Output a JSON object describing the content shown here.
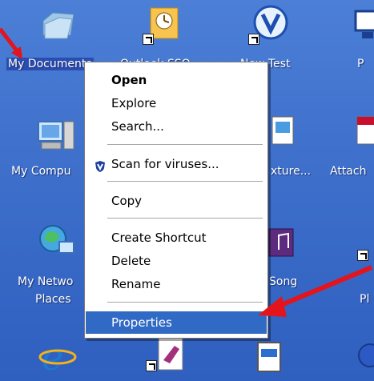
{
  "desktop": {
    "icons": [
      {
        "label": "My Documents"
      },
      {
        "label": "Outlook SSO"
      },
      {
        "label": "New Test"
      },
      {
        "label": "P"
      },
      {
        "label": "My Compu"
      },
      {
        "label": "xture..."
      },
      {
        "label": "Attach"
      },
      {
        "label": "My Netwo"
      },
      {
        "label": "Places"
      },
      {
        "label": "Song"
      },
      {
        "label": "Pl"
      }
    ]
  },
  "context_menu": {
    "items": {
      "open": "Open",
      "explore": "Explore",
      "search": "Search...",
      "scan": "Scan for viruses...",
      "copy": "Copy",
      "create_shortcut": "Create Shortcut",
      "delete": "Delete",
      "rename": "Rename",
      "properties": "Properties"
    }
  },
  "colors": {
    "desktop_blue": "#3d6fcb",
    "menu_highlight": "#316ac5",
    "annotation_red": "#e3141b"
  }
}
